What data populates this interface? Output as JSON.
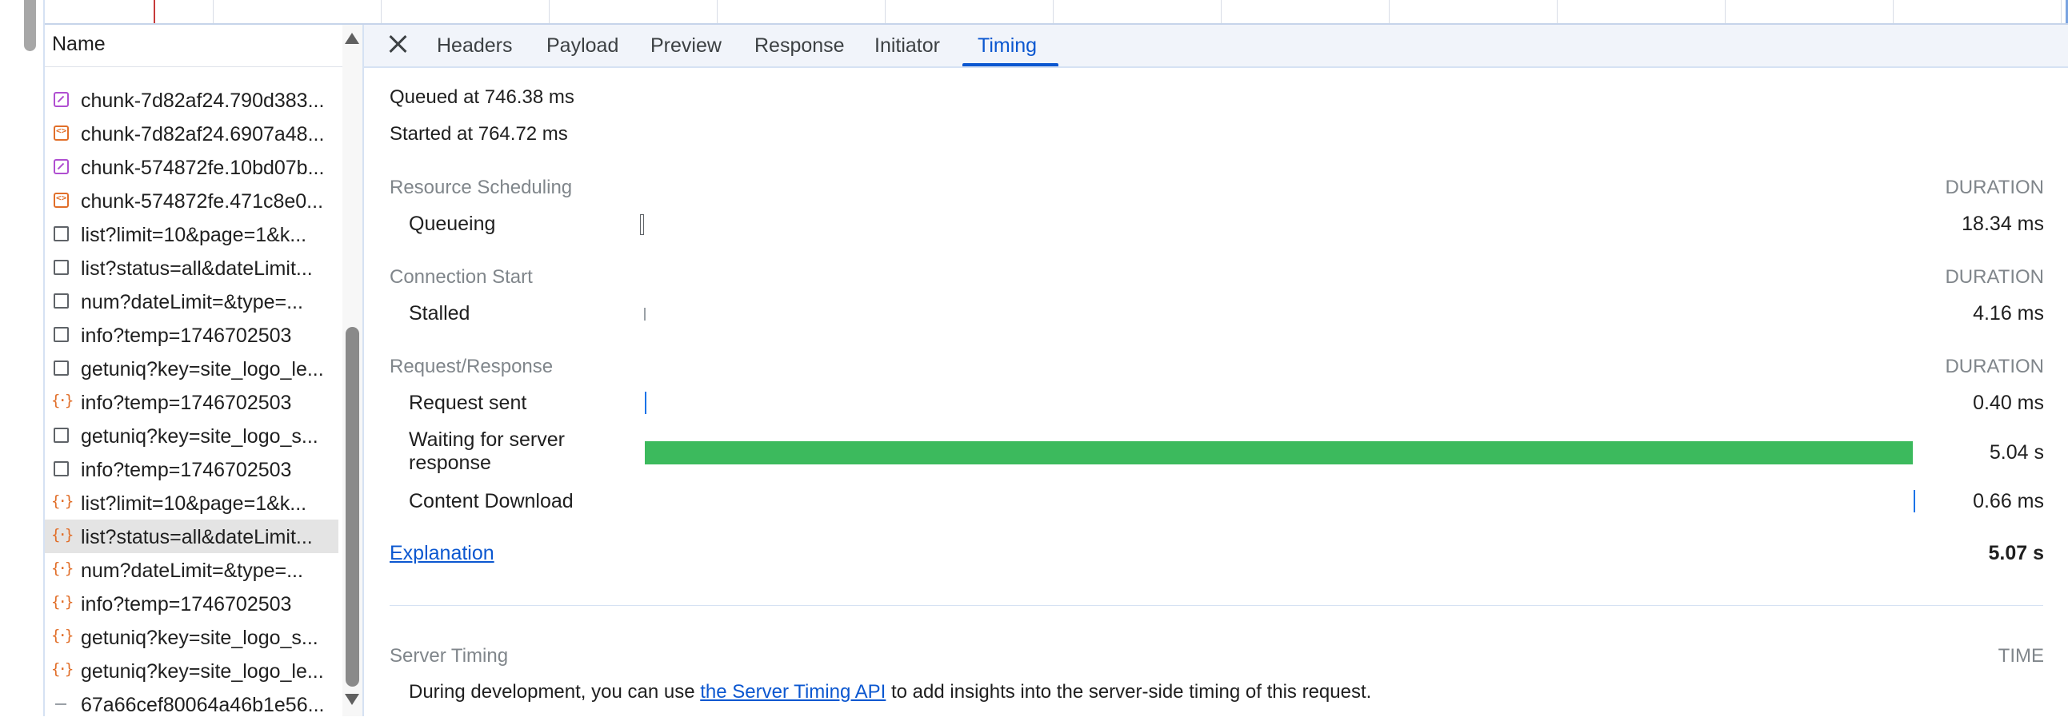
{
  "overview": {
    "ticks": 12
  },
  "request_list": {
    "header": "Name",
    "rows": [
      {
        "icon": "image-icon",
        "label": "chunk-7d82af24.790d383..."
      },
      {
        "icon": "script-icon",
        "label": "chunk-7d82af24.6907a48..."
      },
      {
        "icon": "image-icon",
        "label": "chunk-574872fe.10bd07b..."
      },
      {
        "icon": "script-icon",
        "label": "chunk-574872fe.471c8e0..."
      },
      {
        "icon": "document-icon",
        "label": "list?limit=10&page=1&k..."
      },
      {
        "icon": "document-icon",
        "label": "list?status=all&dateLimit..."
      },
      {
        "icon": "document-icon",
        "label": "num?dateLimit=&type=..."
      },
      {
        "icon": "document-icon",
        "label": "info?temp=1746702503"
      },
      {
        "icon": "document-icon",
        "label": "getuniq?key=site_logo_le..."
      },
      {
        "icon": "json-icon",
        "label": "info?temp=1746702503"
      },
      {
        "icon": "document-icon",
        "label": "getuniq?key=site_logo_s..."
      },
      {
        "icon": "document-icon",
        "label": "info?temp=1746702503"
      },
      {
        "icon": "json-icon",
        "label": "list?limit=10&page=1&k..."
      },
      {
        "icon": "json-icon",
        "label": "list?status=all&dateLimit...",
        "selected": true
      },
      {
        "icon": "json-icon",
        "label": "num?dateLimit=&type=..."
      },
      {
        "icon": "json-icon",
        "label": "info?temp=1746702503"
      },
      {
        "icon": "json-icon",
        "label": "getuniq?key=site_logo_s..."
      },
      {
        "icon": "json-icon",
        "label": "getuniq?key=site_logo_le..."
      },
      {
        "icon": "dash-icon",
        "label": "67a66cef80064a46b1e56..."
      }
    ]
  },
  "tabs": {
    "items": [
      {
        "label": "Headers"
      },
      {
        "label": "Payload"
      },
      {
        "label": "Preview"
      },
      {
        "label": "Response"
      },
      {
        "label": "Initiator"
      },
      {
        "label": "Timing",
        "active": true
      }
    ]
  },
  "timing": {
    "queued": "Queued at 746.38 ms",
    "started": "Started at 764.72 ms",
    "sections": [
      {
        "title": "Resource Scheduling",
        "duration_header": "DURATION",
        "phases": [
          {
            "name": "Queueing",
            "value": "18.34 ms"
          }
        ]
      },
      {
        "title": "Connection Start",
        "duration_header": "DURATION",
        "phases": [
          {
            "name": "Stalled",
            "value": "4.16 ms"
          }
        ]
      },
      {
        "title": "Request/Response",
        "duration_header": "DURATION",
        "phases": [
          {
            "name": "Request sent",
            "value": "0.40 ms"
          },
          {
            "name": "Waiting for server response",
            "value": "5.04 s"
          },
          {
            "name": "Content Download",
            "value": "0.66 ms"
          }
        ]
      }
    ],
    "explanation_link": "Explanation",
    "total": "5.07 s",
    "bar_colors": {
      "queueing": "#ffffff",
      "stalled": "#9aa0a6",
      "request_sent": "#1a73e8",
      "waiting": "#3cba5d",
      "content_download": "#1a73e8"
    },
    "waiting_fraction": 0.994
  },
  "server_timing": {
    "title": "Server Timing",
    "time_header": "TIME",
    "text_before": "During development, you can use ",
    "link": "the Server Timing API",
    "text_after": " to add insights into the server-side timing of this request."
  }
}
